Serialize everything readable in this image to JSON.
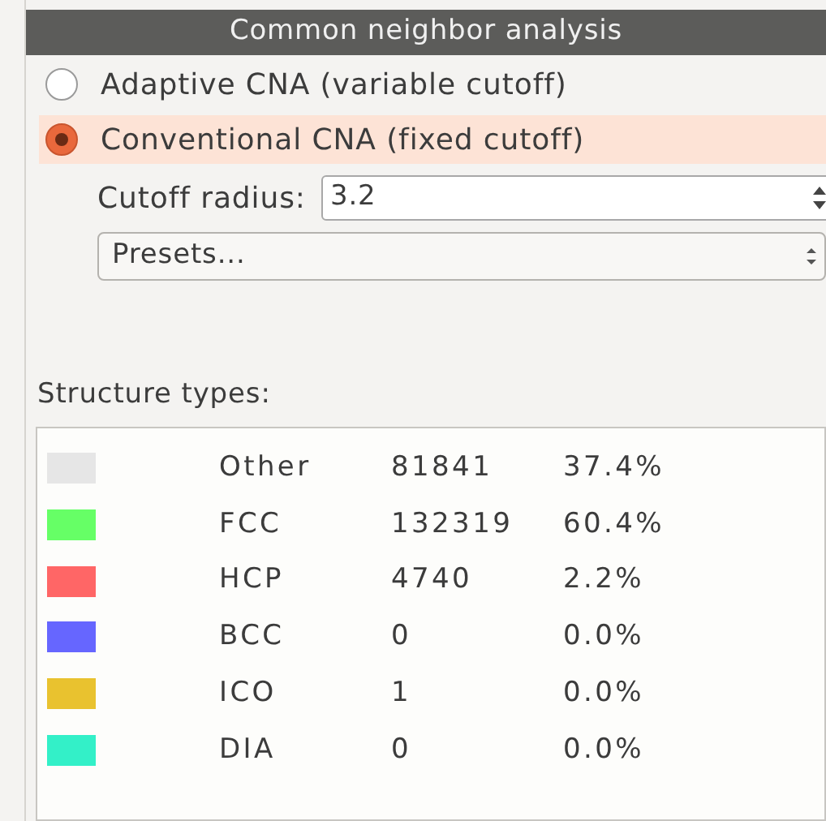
{
  "panel": {
    "title": "Common neighbor analysis"
  },
  "modes": [
    {
      "label": "Adaptive CNA (variable cutoff)",
      "selected": false
    },
    {
      "label": "Conventional CNA (fixed cutoff)",
      "selected": true
    }
  ],
  "cutoff": {
    "label": "Cutoff radius:",
    "value": "3.2"
  },
  "presets": {
    "value": "Presets..."
  },
  "structure_types": {
    "label": "Structure types:",
    "rows": [
      {
        "name": "Other",
        "count": "81841",
        "percent": "37.4%",
        "color": "#e6e6e6"
      },
      {
        "name": "FCC",
        "count": "132319",
        "percent": "60.4%",
        "color": "#66ff66"
      },
      {
        "name": "HCP",
        "count": "4740",
        "percent": "2.2%",
        "color": "#ff6666"
      },
      {
        "name": "BCC",
        "count": "0",
        "percent": "0.0%",
        "color": "#6666ff"
      },
      {
        "name": "ICO",
        "count": "1",
        "percent": "0.0%",
        "color": "#e9c22f"
      },
      {
        "name": "DIA",
        "count": "0",
        "percent": "0.0%",
        "color": "#33f0c8"
      }
    ]
  }
}
